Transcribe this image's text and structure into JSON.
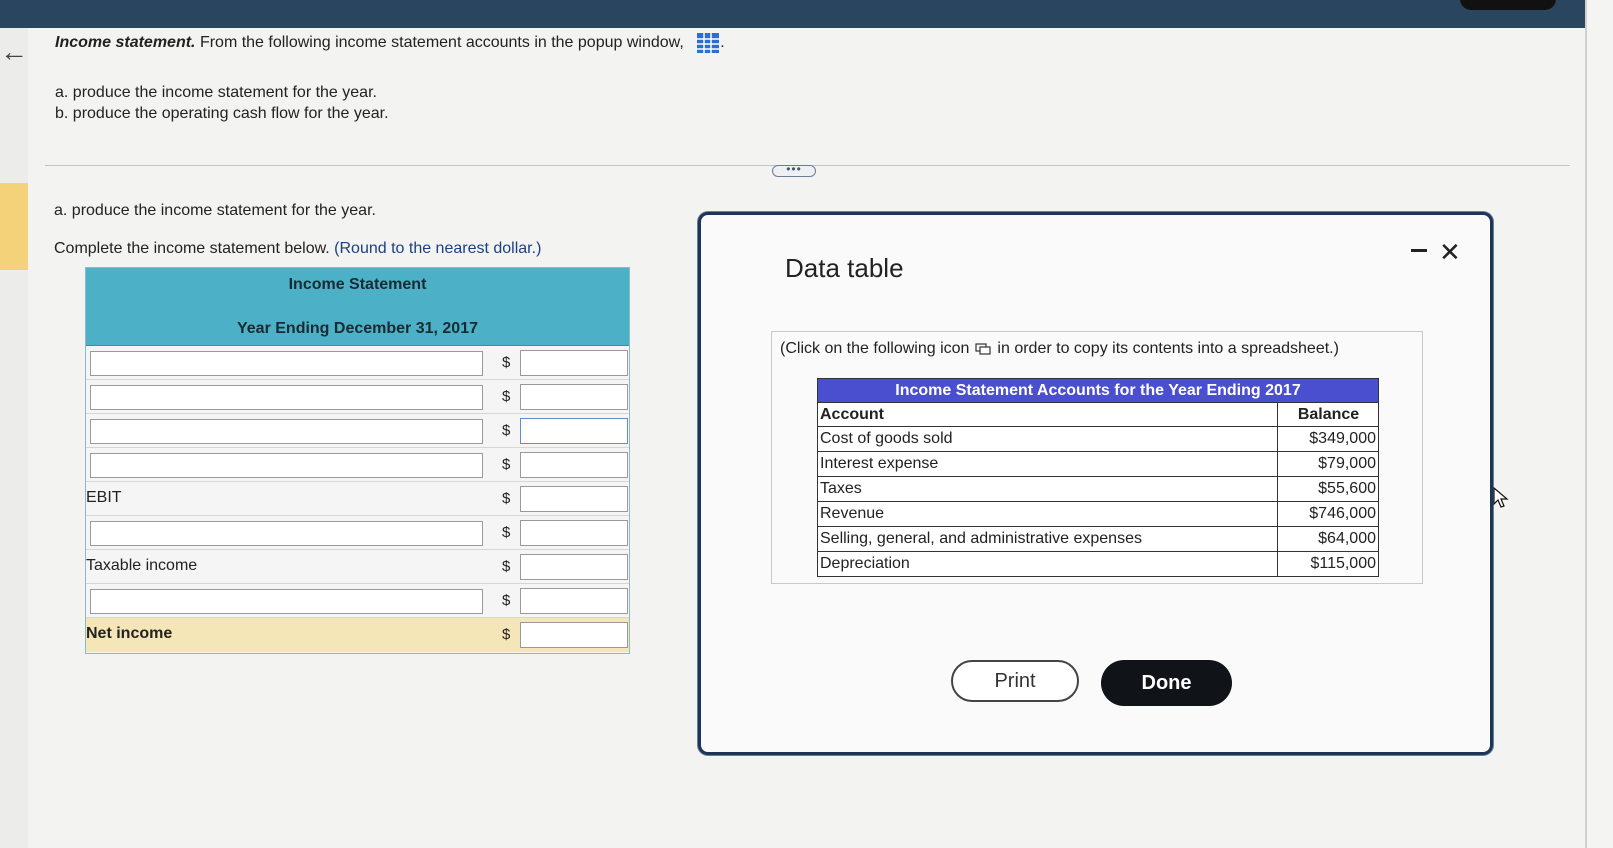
{
  "question": {
    "title": "Income statement.",
    "text": "From the following income statement accounts in the popup window,",
    "item_a": "a. produce the income statement for the year.",
    "item_b": "b. produce the operating cash flow for the year."
  },
  "part_a": {
    "heading": "a. produce the income statement for the year.",
    "instruction": "Complete the income statement below.",
    "rounding": "(Round to the nearest dollar.)"
  },
  "income_statement": {
    "title": "Income Statement",
    "period": "Year Ending December 31, 2017",
    "currency": "$",
    "rows": [
      {
        "type": "input"
      },
      {
        "type": "input"
      },
      {
        "type": "input"
      },
      {
        "type": "input"
      },
      {
        "type": "label",
        "label": "EBIT"
      },
      {
        "type": "input"
      },
      {
        "type": "label",
        "label": "Taxable income"
      },
      {
        "type": "input"
      },
      {
        "type": "label",
        "label": "Net income"
      }
    ]
  },
  "modal": {
    "title": "Data table",
    "copy_note_before": "(Click on the following icon",
    "copy_note_after": "in order to copy its contents into a spreadsheet.)",
    "table": {
      "caption": "Income Statement Accounts for the Year Ending 2017",
      "headers": [
        "Account",
        "Balance"
      ],
      "rows": [
        [
          "Cost of goods sold",
          "$349,000"
        ],
        [
          "Interest expense",
          "$79,000"
        ],
        [
          "Taxes",
          "$55,600"
        ],
        [
          "Revenue",
          "$746,000"
        ],
        [
          "Selling, general, and administrative expenses",
          "$64,000"
        ],
        [
          "Depreciation",
          "$115,000"
        ]
      ]
    },
    "print_label": "Print",
    "done_label": "Done"
  },
  "icons": {
    "back": "arrow-left-icon",
    "grid": "data-grid-icon",
    "copy": "copy-icon",
    "minimize": "minimize-icon",
    "close": "close-icon",
    "more": "more-dots-icon"
  },
  "colors": {
    "header_teal": "#4cb1c7",
    "net_income_row": "#f5e6b8",
    "table_caption": "#4a4fd0",
    "done_button": "#101418",
    "rounding_text": "#1d3f84"
  }
}
